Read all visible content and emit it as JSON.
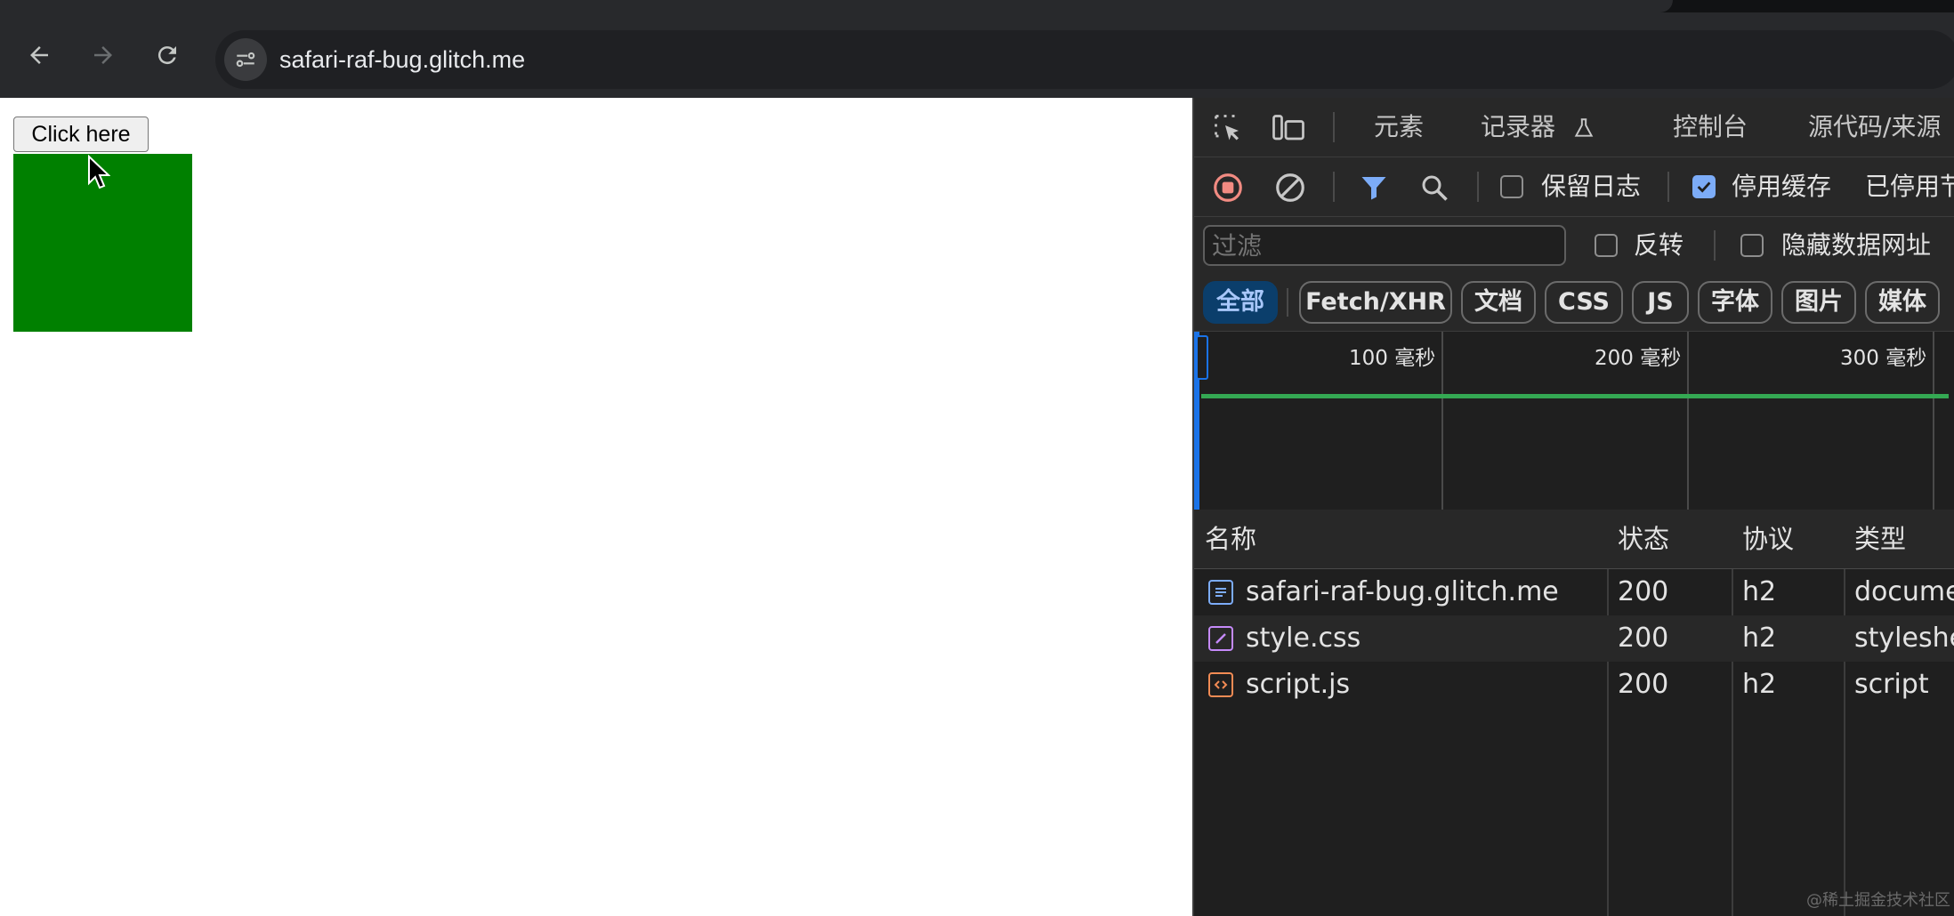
{
  "browser": {
    "url": "safari-raf-bug.glitch.me",
    "icons": [
      "back-icon",
      "forward-icon",
      "reload-icon",
      "site-info-icon"
    ]
  },
  "page": {
    "button_label": "Click here",
    "box_color": "#008000"
  },
  "devtools": {
    "tabs": [
      "元素",
      "记录器",
      "控制台",
      "源代码/来源"
    ],
    "controls": {
      "preserve_log": "保留日志",
      "disable_cache": "停用缓存",
      "throttling": "已停用节"
    },
    "filter": {
      "placeholder": "过滤",
      "invert": "反转",
      "hide_data_urls": "隐藏数据网址"
    },
    "type_filters": [
      "全部",
      "Fetch/XHR",
      "文档",
      "CSS",
      "JS",
      "字体",
      "图片",
      "媒体"
    ],
    "timeline_ticks": [
      "100 毫秒",
      "200 毫秒",
      "300 毫秒"
    ],
    "columns": [
      "名称",
      "状态",
      "协议",
      "类型"
    ],
    "requests": [
      {
        "name": "safari-raf-bug.glitch.me",
        "status": "200",
        "protocol": "h2",
        "type": "document",
        "icon": "document-file-icon",
        "color": "#7cacf8"
      },
      {
        "name": "style.css",
        "status": "200",
        "protocol": "h2",
        "type": "stylesheet",
        "icon": "stylesheet-file-icon",
        "color": "#c58af9"
      },
      {
        "name": "script.js",
        "status": "200",
        "protocol": "h2",
        "type": "script",
        "icon": "script-file-icon",
        "color": "#f28b54"
      }
    ]
  },
  "watermark": "@稀土掘金技术社区"
}
